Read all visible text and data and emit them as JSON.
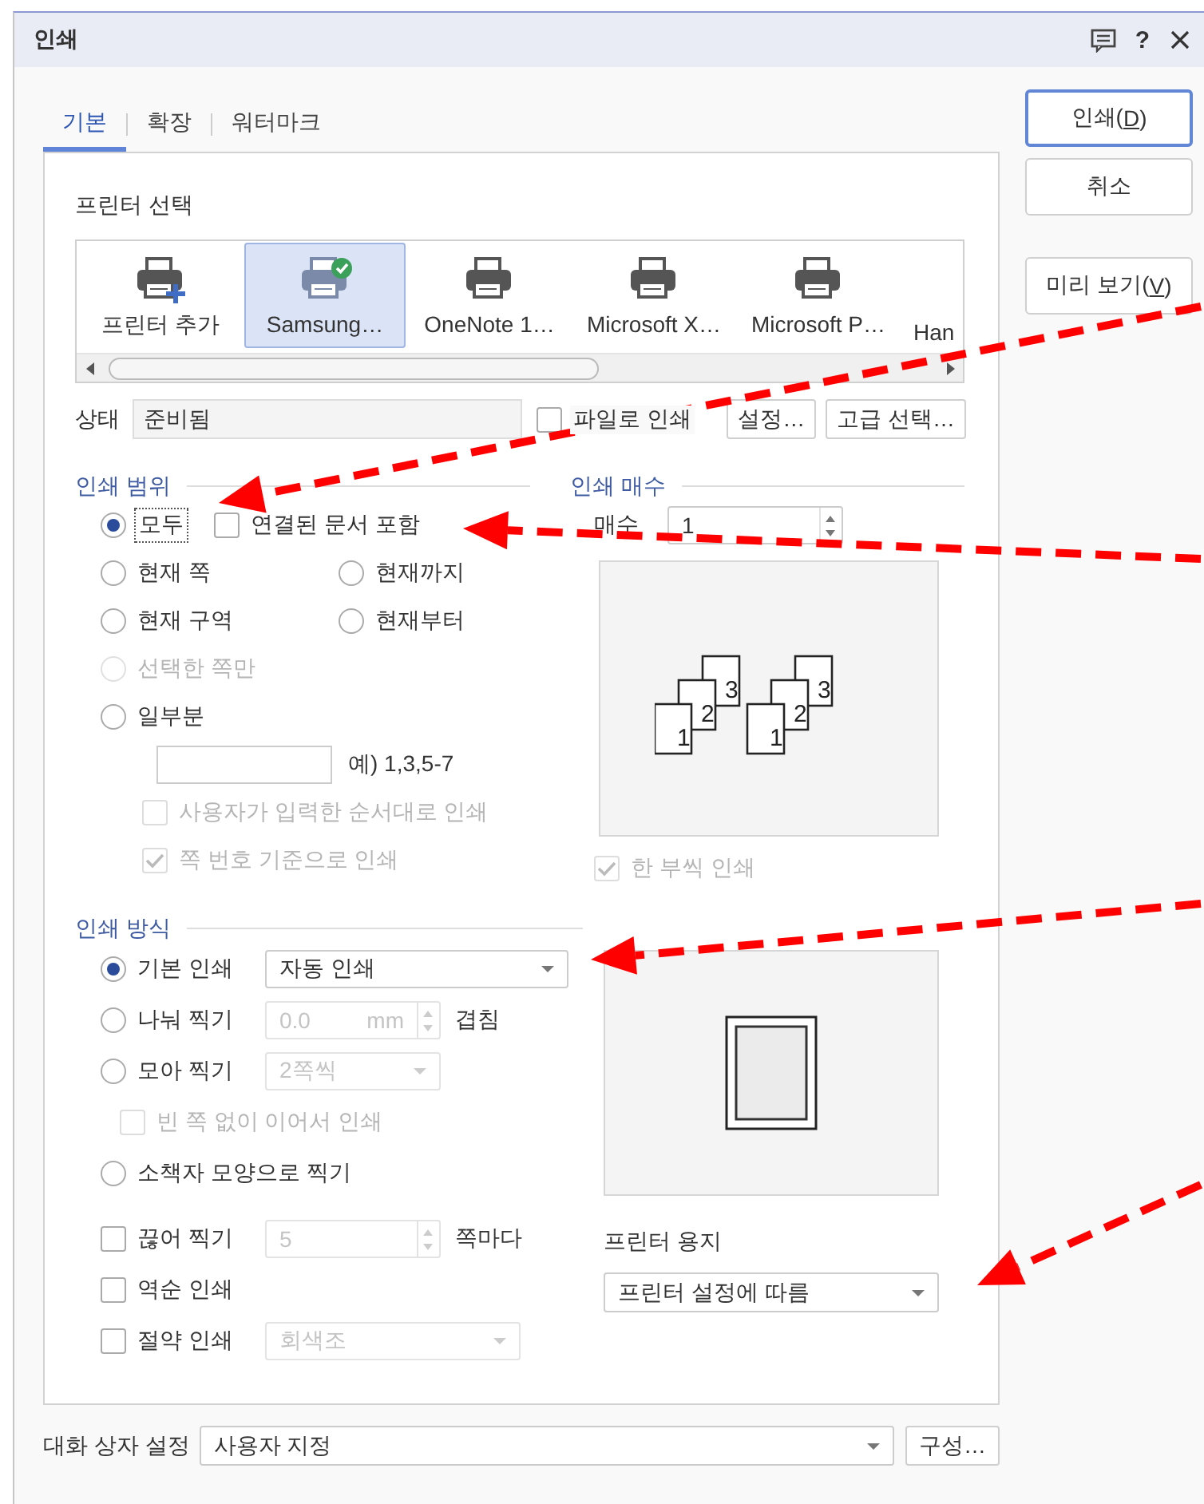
{
  "window": {
    "title": "인쇄",
    "help": "?"
  },
  "tabs": [
    {
      "label": "기본",
      "selected": true
    },
    {
      "label": "확장",
      "selected": false
    },
    {
      "label": "워터마크",
      "selected": false
    }
  ],
  "printer_select": {
    "heading": "프린터 선택",
    "printers": [
      {
        "name": "프린터 추가",
        "kind": "add",
        "selected": false
      },
      {
        "name": "Samsung…",
        "kind": "default",
        "selected": true
      },
      {
        "name": "OneNote 1…",
        "kind": "printer",
        "selected": false
      },
      {
        "name": "Microsoft X…",
        "kind": "printer",
        "selected": false
      },
      {
        "name": "Microsoft P…",
        "kind": "printer",
        "selected": false
      },
      {
        "name": "Han",
        "kind": "partial",
        "selected": false
      }
    ]
  },
  "status": {
    "label": "상태",
    "value": "준비됨"
  },
  "print_to_file": {
    "label": "파일로 인쇄",
    "checked": false
  },
  "printer_buttons": [
    "설정…",
    "고급 선택…"
  ],
  "range": {
    "heading": "인쇄 범위",
    "all": {
      "label": "모두",
      "selected": true,
      "focused": true
    },
    "linked_docs": {
      "label": "연결된 문서 포함",
      "checked": false
    },
    "options": [
      {
        "label": "현재 쪽",
        "selected": false,
        "disabled": false
      },
      {
        "label": "현재까지",
        "selected": false,
        "disabled": false
      },
      {
        "label": "현재 구역",
        "selected": false,
        "disabled": false
      },
      {
        "label": "현재부터",
        "selected": false,
        "disabled": false
      },
      {
        "label": "선택한 쪽만",
        "selected": false,
        "disabled": true
      },
      {
        "label": "일부분",
        "selected": false,
        "disabled": false
      }
    ],
    "pages_hint": "예) 1,3,5-7",
    "checks": [
      {
        "label": "사용자가 입력한 순서대로 인쇄",
        "checked": false,
        "disabled": true
      },
      {
        "label": "쪽 번호 기준으로 인쇄",
        "checked": true,
        "disabled": true
      }
    ]
  },
  "copies": {
    "heading": "인쇄 매수",
    "label": "매수",
    "value": "1",
    "collate_sets": [
      [
        "1",
        "2",
        "3"
      ],
      [
        "1",
        "2",
        "3"
      ]
    ],
    "collate": {
      "label": "한 부씩 인쇄",
      "checked": true,
      "disabled": true
    }
  },
  "method": {
    "heading": "인쇄 방식",
    "items": [
      {
        "kind": "radio",
        "label": "기본 인쇄",
        "selected": true,
        "control": {
          "kind": "combo",
          "value": "자동 인쇄",
          "disabled": false
        }
      },
      {
        "kind": "radio",
        "label": "나눠 찍기",
        "selected": false,
        "control": {
          "kind": "spin",
          "value": "0.0",
          "unit": "mm",
          "disabled": true
        },
        "suffix": "겹침"
      },
      {
        "kind": "radio",
        "label": "모아 찍기",
        "selected": false,
        "control": {
          "kind": "combo",
          "value": "2쪽씩",
          "disabled": true
        }
      },
      {
        "kind": "check",
        "label": "빈 쪽 없이 이어서 인쇄",
        "checked": false,
        "disabled": true
      },
      {
        "kind": "radio",
        "label": "소책자 모양으로 찍기",
        "selected": false
      }
    ],
    "extras": [
      {
        "label": "끊어 찍기",
        "checked": false,
        "control": {
          "kind": "spin",
          "value": "5",
          "disabled": true
        },
        "suffix": "쪽마다"
      },
      {
        "label": "역순 인쇄",
        "checked": false
      },
      {
        "label": "절약 인쇄",
        "checked": false,
        "control": {
          "kind": "combo",
          "value": "회색조",
          "disabled": true
        }
      }
    ]
  },
  "paper": {
    "label": "프린터 용지",
    "value": "프린터 설정에 따름"
  },
  "side_buttons": [
    {
      "before": "인쇄(",
      "key": "D",
      "after": ")",
      "default": true
    },
    {
      "before": "취소",
      "default": false
    },
    {
      "before": "미리 보기(",
      "key": "V",
      "after": ")",
      "default": false
    }
  ],
  "dialog_settings": {
    "label": "대화 상자 설정",
    "value": "사용자 지정",
    "button": "구성…"
  },
  "annotation_arrows": [
    {
      "kind": "dashed-arrow"
    },
    {
      "kind": "dashed-arrow"
    },
    {
      "kind": "dashed-arrow"
    },
    {
      "kind": "dashed-arrow"
    }
  ]
}
